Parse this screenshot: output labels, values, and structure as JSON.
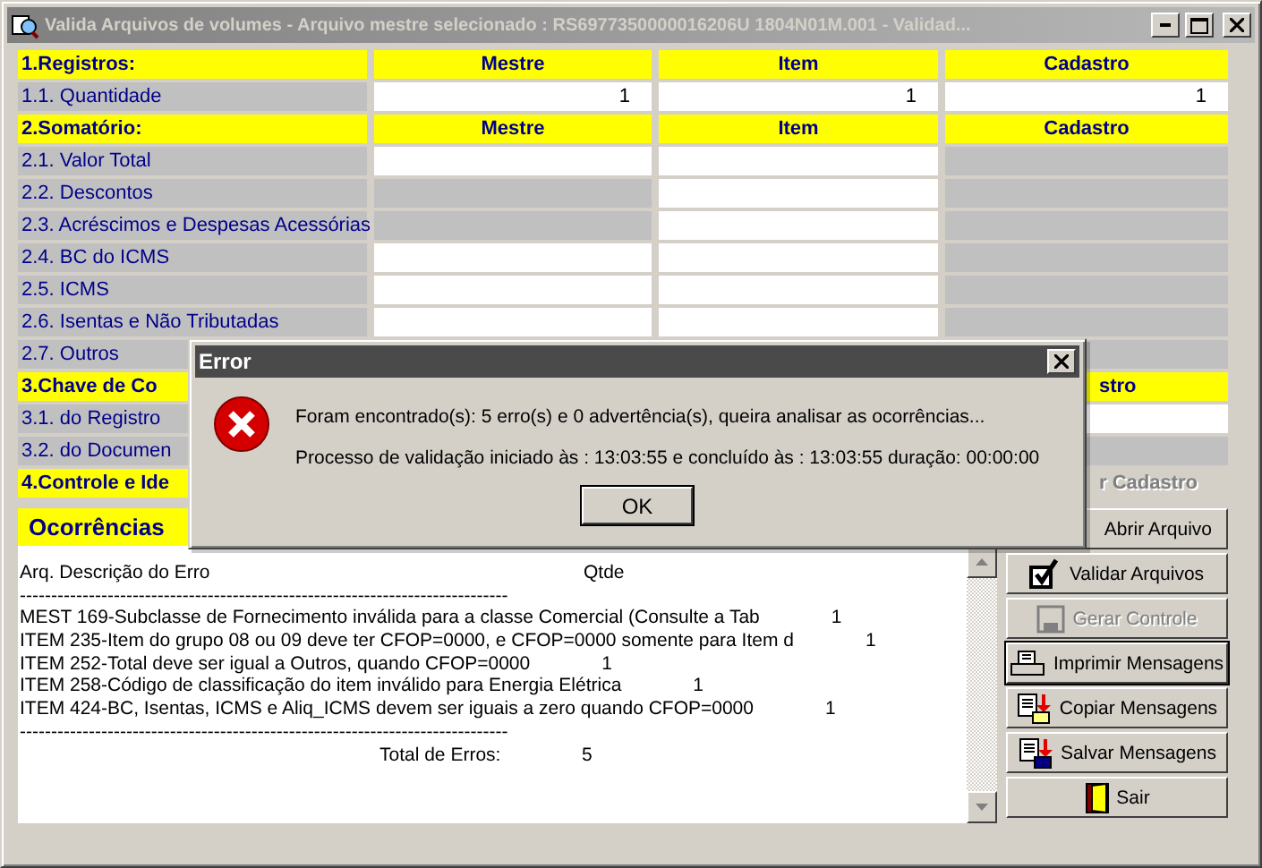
{
  "window": {
    "title": "Valida Arquivos de volumes - Arquivo mestre selecionado : RS6977350000016206U  1804N01M.001  - Validad..."
  },
  "grid": [
    {
      "kind": "header",
      "label": "1.Registros:",
      "mestre": "Mestre",
      "item": "Item",
      "cadastro": "Cadastro"
    },
    {
      "kind": "row",
      "label": "1.1. Quantidade",
      "mestre": {
        "editable": true,
        "value": "1"
      },
      "item": {
        "editable": true,
        "value": "1"
      },
      "cadastro": {
        "editable": true,
        "value": "1"
      }
    },
    {
      "kind": "header",
      "label": "2.Somatório:",
      "mestre": "Mestre",
      "item": "Item",
      "cadastro": "Cadastro"
    },
    {
      "kind": "row",
      "label": "2.1. Valor Total",
      "mestre": {
        "editable": true
      },
      "item": {
        "editable": true
      },
      "cadastro": {
        "editable": false
      }
    },
    {
      "kind": "row",
      "label": "2.2. Descontos",
      "mestre": {
        "editable": false
      },
      "item": {
        "editable": true
      },
      "cadastro": {
        "editable": false
      }
    },
    {
      "kind": "row",
      "label": "2.3. Acréscimos e Despesas Acessórias",
      "mestre": {
        "editable": false
      },
      "item": {
        "editable": true
      },
      "cadastro": {
        "editable": false
      }
    },
    {
      "kind": "row",
      "label": "2.4. BC do ICMS",
      "mestre": {
        "editable": true
      },
      "item": {
        "editable": true
      },
      "cadastro": {
        "editable": false
      }
    },
    {
      "kind": "row",
      "label": "2.5. ICMS",
      "mestre": {
        "editable": true
      },
      "item": {
        "editable": true
      },
      "cadastro": {
        "editable": false
      }
    },
    {
      "kind": "row",
      "label": "2.6. Isentas e Não Tributadas",
      "mestre": {
        "editable": true
      },
      "item": {
        "editable": true
      },
      "cadastro": {
        "editable": false
      }
    },
    {
      "kind": "row",
      "label": "2.7. Outros",
      "cadastro": {
        "editable": false
      }
    },
    {
      "kind": "header",
      "label": "3.Chave de Co",
      "cadastro": "stro"
    },
    {
      "kind": "row",
      "label": "3.1. do Registro",
      "cadastro": {
        "editable": true
      }
    },
    {
      "kind": "row",
      "label": "3.2. do Documen",
      "cadastro": {
        "editable": false
      }
    },
    {
      "kind": "header",
      "label": "4.Controle e Ide",
      "action": {
        "label": "r Cadastro",
        "disabled": true
      }
    }
  ],
  "occurrences": {
    "title": "Ocorrências",
    "lines": [
      {
        "kind": "header",
        "text": "Arq. Descrição do Erro",
        "qtde": "Qtde"
      },
      {
        "kind": "rule",
        "text": "------------------------------------------------------------------------------"
      },
      {
        "kind": "error",
        "text": "MEST 169-Subclasse de Fornecimento inválida para a classe Comercial (Consulte a Tab",
        "qtde": "1"
      },
      {
        "kind": "error",
        "text": "ITEM 235-Item do grupo 08 ou 09 deve ter CFOP=0000, e CFOP=0000 somente para Item d",
        "qtde": "1"
      },
      {
        "kind": "error",
        "text": "ITEM 252-Total deve ser igual a Outros, quando CFOP=0000",
        "qtde": "1"
      },
      {
        "kind": "error",
        "text": "ITEM 258-Código de classificação do item inválido para Energia Elétrica",
        "qtde": "1"
      },
      {
        "kind": "error",
        "text": "ITEM 424-BC, Isentas, ICMS e Aliq_ICMS devem ser iguais a zero quando CFOP=0000",
        "qtde": "1"
      },
      {
        "kind": "rule",
        "text": "------------------------------------------------------------------------------"
      },
      {
        "kind": "total",
        "text": "Total de Erros:",
        "qtde": "5"
      }
    ]
  },
  "buttons": [
    {
      "label": "Abrir Arquivo",
      "kind": "text",
      "disabled": false,
      "default": false
    },
    {
      "label": "Validar Arquivos",
      "kind": "check",
      "disabled": false,
      "default": false
    },
    {
      "label": "Gerar Controle",
      "kind": "floppy",
      "disabled": true,
      "default": false
    },
    {
      "label": "Imprimir Mensagens",
      "kind": "printer",
      "disabled": false,
      "default": true
    },
    {
      "label": "Copiar Mensagens",
      "kind": "copy",
      "disabled": false,
      "default": false
    },
    {
      "label": "Salvar Mensagens",
      "kind": "save",
      "disabled": false,
      "default": false
    },
    {
      "label": "Sair",
      "kind": "door",
      "disabled": false,
      "default": false
    }
  ],
  "dialog": {
    "title": "Error",
    "messages": [
      "Foram encontrado(s): 5 erro(s) e 0 advertência(s), queira analisar as ocorrências...",
      "Processo de validação iniciado às : 13:03:55 e concluído às : 13:03:55 duração: 00:00:00"
    ],
    "button": "OK"
  }
}
